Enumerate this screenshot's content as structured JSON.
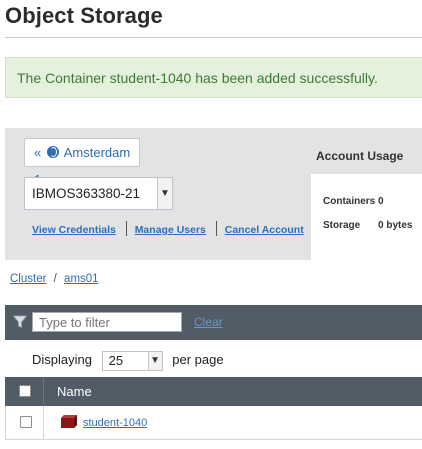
{
  "page": {
    "title": "Object Storage"
  },
  "alert": {
    "message": "The Container student-1040 has been added successfully."
  },
  "panel": {
    "region_button": {
      "prefix": "«",
      "label": "Amsterdam 1",
      "icon": "globe-icon"
    },
    "account_select": {
      "value": "IBMOS363380-21"
    },
    "links": {
      "view_credentials": "View Credentials",
      "manage_users": "Manage Users",
      "cancel_account": "Cancel Account"
    },
    "usage": {
      "title": "Account Usage",
      "containers_label": "Containers",
      "containers_value": "0",
      "storage_label": "Storage",
      "storage_value": "0 bytes"
    }
  },
  "breadcrumb": {
    "cluster": "Cluster",
    "separator": "/",
    "location": "ams01"
  },
  "filter": {
    "icon": "funnel-icon",
    "placeholder": "Type to filter",
    "clear_label": "Clear"
  },
  "paging": {
    "displaying_label": "Displaying",
    "per_page_value": "25",
    "per_page_label": "per page"
  },
  "table": {
    "columns": [
      "Name"
    ],
    "rows": [
      {
        "name": "student-1040",
        "icon": "container-icon"
      }
    ]
  },
  "colors": {
    "accent": "#2f6db5",
    "toolbar": "#515c67",
    "success_bg": "#e4f1dd",
    "success_text": "#3f7a35",
    "container_icon": "#9b1b1b"
  }
}
